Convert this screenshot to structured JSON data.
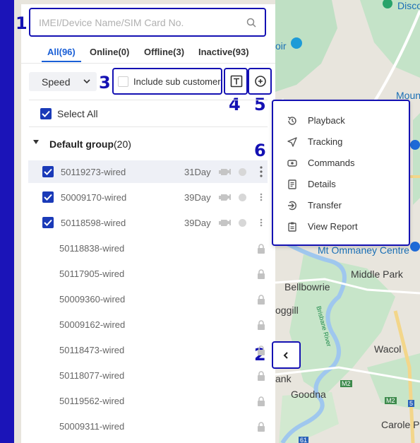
{
  "search": {
    "placeholder": "IMEI/Device Name/SIM Card No."
  },
  "tabs": [
    {
      "label": "All(96)",
      "active": true
    },
    {
      "label": "Online(0)",
      "active": false
    },
    {
      "label": "Offline(3)",
      "active": false
    },
    {
      "label": "Inactive(93)",
      "active": false
    }
  ],
  "filter": {
    "sort_value": "Speed",
    "sub_customer_label": "Include sub customer"
  },
  "select_all_label": "Select All",
  "group": {
    "name": "Default group",
    "count": "(20)"
  },
  "devices": [
    {
      "name": "50119273-wired",
      "days": "31Day",
      "checked": true
    },
    {
      "name": "50009170-wired",
      "days": "39Day",
      "checked": true
    },
    {
      "name": "50118598-wired",
      "days": "39Day",
      "checked": true
    },
    {
      "name": "50118838-wired"
    },
    {
      "name": "50117905-wired"
    },
    {
      "name": "50009360-wired"
    },
    {
      "name": "50009162-wired"
    },
    {
      "name": "50118473-wired"
    },
    {
      "name": "50118077-wired"
    },
    {
      "name": "50119562-wired"
    },
    {
      "name": "50009311-wired"
    }
  ],
  "context_menu": [
    {
      "label": "Playback",
      "icon": "playback-icon"
    },
    {
      "label": "Tracking",
      "icon": "tracking-icon"
    },
    {
      "label": "Commands",
      "icon": "commands-icon"
    },
    {
      "label": "Details",
      "icon": "details-icon"
    },
    {
      "label": "Transfer",
      "icon": "transfer-icon"
    },
    {
      "label": "View Report",
      "icon": "view-report-icon"
    }
  ],
  "annotations": [
    "1",
    "2",
    "3",
    "4",
    "5",
    "6"
  ],
  "map_labels": {
    "disco": "Disco",
    "oir": "oir",
    "mount_co": "Mount Co",
    "mt_ommaney": "Mt Ommaney Centre",
    "middle_park": "Middle Park",
    "bellbowrie": "Bellbowrie",
    "oggill": "oggill",
    "brisbane_river": "Brisbane River",
    "wacol": "Wacol",
    "ank": "ank",
    "goodna": "Goodna",
    "carole_park": "Carole Pa",
    "m2": "M2",
    "n61": "61",
    "n5": "5"
  },
  "colors": {
    "accent": "#1a5fd6",
    "annotation": "#1411b3",
    "sidebar": "#1b14b8",
    "checkbox": "#1a3ab8"
  }
}
